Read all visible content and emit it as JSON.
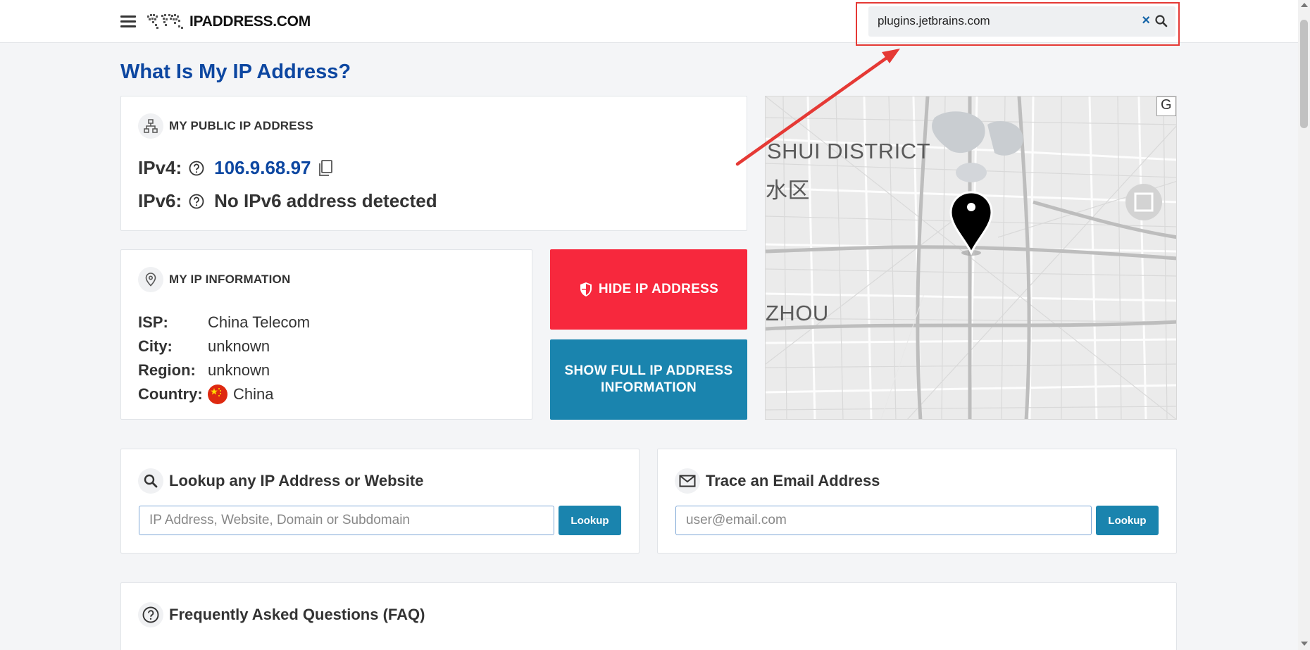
{
  "header": {
    "logo_text": "IPADDRESS.COM",
    "search_value": "plugins.jetbrains.com",
    "clear_glyph": "×"
  },
  "page": {
    "title": "What Is My IP Address?"
  },
  "public_ip": {
    "heading": "MY PUBLIC IP ADDRESS",
    "ipv4_label": "IPv4:",
    "ipv4_value": "106.9.68.97",
    "ipv6_label": "IPv6:",
    "ipv6_value": "No IPv6 address detected"
  },
  "ip_info": {
    "heading": "MY IP INFORMATION",
    "rows": [
      {
        "key": "ISP:",
        "value": "China Telecom"
      },
      {
        "key": "City:",
        "value": "unknown"
      },
      {
        "key": "Region:",
        "value": "unknown"
      },
      {
        "key": "Country:",
        "value": "China"
      }
    ]
  },
  "buttons": {
    "hide_ip": "HIDE IP ADDRESS",
    "show_full": "SHOW FULL IP ADDRESS INFORMATION"
  },
  "map": {
    "label_1": "SHUI DISTRICT",
    "label_2": "水区",
    "label_3": "ZHOU",
    "corner": "G"
  },
  "lookup": {
    "title": "Lookup any IP Address or Website",
    "placeholder": "IP Address, Website, Domain or Subdomain",
    "button": "Lookup"
  },
  "email": {
    "title": "Trace an Email Address",
    "placeholder": "user@email.com",
    "button": "Lookup"
  },
  "faq": {
    "title": "Frequently Asked Questions (FAQ)"
  },
  "colors": {
    "brand_blue": "#0d47a1",
    "hide_red": "#f7283d",
    "action_teal": "#1a84ae",
    "annotation_red": "#e53935"
  }
}
